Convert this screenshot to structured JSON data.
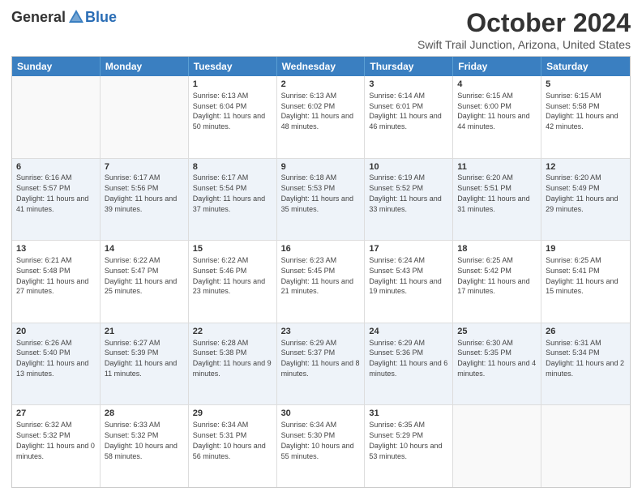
{
  "header": {
    "logo_general": "General",
    "logo_blue": "Blue",
    "month_title": "October 2024",
    "location": "Swift Trail Junction, Arizona, United States"
  },
  "days_of_week": [
    "Sunday",
    "Monday",
    "Tuesday",
    "Wednesday",
    "Thursday",
    "Friday",
    "Saturday"
  ],
  "weeks": [
    [
      {
        "day": "",
        "info": ""
      },
      {
        "day": "",
        "info": ""
      },
      {
        "day": "1",
        "info": "Sunrise: 6:13 AM\nSunset: 6:04 PM\nDaylight: 11 hours and 50 minutes."
      },
      {
        "day": "2",
        "info": "Sunrise: 6:13 AM\nSunset: 6:02 PM\nDaylight: 11 hours and 48 minutes."
      },
      {
        "day": "3",
        "info": "Sunrise: 6:14 AM\nSunset: 6:01 PM\nDaylight: 11 hours and 46 minutes."
      },
      {
        "day": "4",
        "info": "Sunrise: 6:15 AM\nSunset: 6:00 PM\nDaylight: 11 hours and 44 minutes."
      },
      {
        "day": "5",
        "info": "Sunrise: 6:15 AM\nSunset: 5:58 PM\nDaylight: 11 hours and 42 minutes."
      }
    ],
    [
      {
        "day": "6",
        "info": "Sunrise: 6:16 AM\nSunset: 5:57 PM\nDaylight: 11 hours and 41 minutes."
      },
      {
        "day": "7",
        "info": "Sunrise: 6:17 AM\nSunset: 5:56 PM\nDaylight: 11 hours and 39 minutes."
      },
      {
        "day": "8",
        "info": "Sunrise: 6:17 AM\nSunset: 5:54 PM\nDaylight: 11 hours and 37 minutes."
      },
      {
        "day": "9",
        "info": "Sunrise: 6:18 AM\nSunset: 5:53 PM\nDaylight: 11 hours and 35 minutes."
      },
      {
        "day": "10",
        "info": "Sunrise: 6:19 AM\nSunset: 5:52 PM\nDaylight: 11 hours and 33 minutes."
      },
      {
        "day": "11",
        "info": "Sunrise: 6:20 AM\nSunset: 5:51 PM\nDaylight: 11 hours and 31 minutes."
      },
      {
        "day": "12",
        "info": "Sunrise: 6:20 AM\nSunset: 5:49 PM\nDaylight: 11 hours and 29 minutes."
      }
    ],
    [
      {
        "day": "13",
        "info": "Sunrise: 6:21 AM\nSunset: 5:48 PM\nDaylight: 11 hours and 27 minutes."
      },
      {
        "day": "14",
        "info": "Sunrise: 6:22 AM\nSunset: 5:47 PM\nDaylight: 11 hours and 25 minutes."
      },
      {
        "day": "15",
        "info": "Sunrise: 6:22 AM\nSunset: 5:46 PM\nDaylight: 11 hours and 23 minutes."
      },
      {
        "day": "16",
        "info": "Sunrise: 6:23 AM\nSunset: 5:45 PM\nDaylight: 11 hours and 21 minutes."
      },
      {
        "day": "17",
        "info": "Sunrise: 6:24 AM\nSunset: 5:43 PM\nDaylight: 11 hours and 19 minutes."
      },
      {
        "day": "18",
        "info": "Sunrise: 6:25 AM\nSunset: 5:42 PM\nDaylight: 11 hours and 17 minutes."
      },
      {
        "day": "19",
        "info": "Sunrise: 6:25 AM\nSunset: 5:41 PM\nDaylight: 11 hours and 15 minutes."
      }
    ],
    [
      {
        "day": "20",
        "info": "Sunrise: 6:26 AM\nSunset: 5:40 PM\nDaylight: 11 hours and 13 minutes."
      },
      {
        "day": "21",
        "info": "Sunrise: 6:27 AM\nSunset: 5:39 PM\nDaylight: 11 hours and 11 minutes."
      },
      {
        "day": "22",
        "info": "Sunrise: 6:28 AM\nSunset: 5:38 PM\nDaylight: 11 hours and 9 minutes."
      },
      {
        "day": "23",
        "info": "Sunrise: 6:29 AM\nSunset: 5:37 PM\nDaylight: 11 hours and 8 minutes."
      },
      {
        "day": "24",
        "info": "Sunrise: 6:29 AM\nSunset: 5:36 PM\nDaylight: 11 hours and 6 minutes."
      },
      {
        "day": "25",
        "info": "Sunrise: 6:30 AM\nSunset: 5:35 PM\nDaylight: 11 hours and 4 minutes."
      },
      {
        "day": "26",
        "info": "Sunrise: 6:31 AM\nSunset: 5:34 PM\nDaylight: 11 hours and 2 minutes."
      }
    ],
    [
      {
        "day": "27",
        "info": "Sunrise: 6:32 AM\nSunset: 5:32 PM\nDaylight: 11 hours and 0 minutes."
      },
      {
        "day": "28",
        "info": "Sunrise: 6:33 AM\nSunset: 5:32 PM\nDaylight: 10 hours and 58 minutes."
      },
      {
        "day": "29",
        "info": "Sunrise: 6:34 AM\nSunset: 5:31 PM\nDaylight: 10 hours and 56 minutes."
      },
      {
        "day": "30",
        "info": "Sunrise: 6:34 AM\nSunset: 5:30 PM\nDaylight: 10 hours and 55 minutes."
      },
      {
        "day": "31",
        "info": "Sunrise: 6:35 AM\nSunset: 5:29 PM\nDaylight: 10 hours and 53 minutes."
      },
      {
        "day": "",
        "info": ""
      },
      {
        "day": "",
        "info": ""
      }
    ]
  ]
}
